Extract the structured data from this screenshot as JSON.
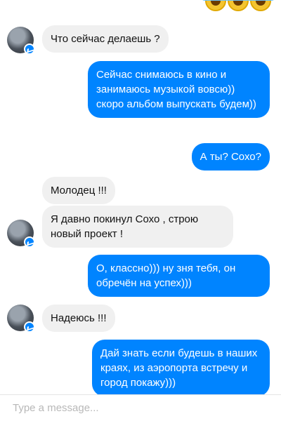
{
  "top_emojis": [
    "laughing-crying-emoji",
    "laughing-crying-emoji",
    "laughing-crying-emoji"
  ],
  "messages": [
    {
      "from": "them",
      "text": "Что сейчас делаешь ?"
    },
    {
      "from": "me",
      "text": "Сейчас снимаюсь в кино и занимаюсь музыкой вовсю)) скоро альбом выпускать будем))"
    },
    {
      "from": "me",
      "text": "А ты? Сохо?"
    },
    {
      "from": "them",
      "text": "Молодец !!!"
    },
    {
      "from": "them",
      "text": "Я давно покинул Сохо , строю новый проект !"
    },
    {
      "from": "me",
      "text": "О, классно))) ну зня тебя, он обречён на успех)))"
    },
    {
      "from": "them",
      "text": "Надеюсь !!!"
    },
    {
      "from": "me",
      "text": "Дай знать если будешь в наших краях,  из аэропорта встречу и город покажу)))"
    }
  ],
  "composer": {
    "placeholder": "Type a message..."
  },
  "colors": {
    "outgoing_bubble": "#0084ff",
    "incoming_bubble": "#f0f0f0",
    "messenger_badge": "#0084ff"
  }
}
